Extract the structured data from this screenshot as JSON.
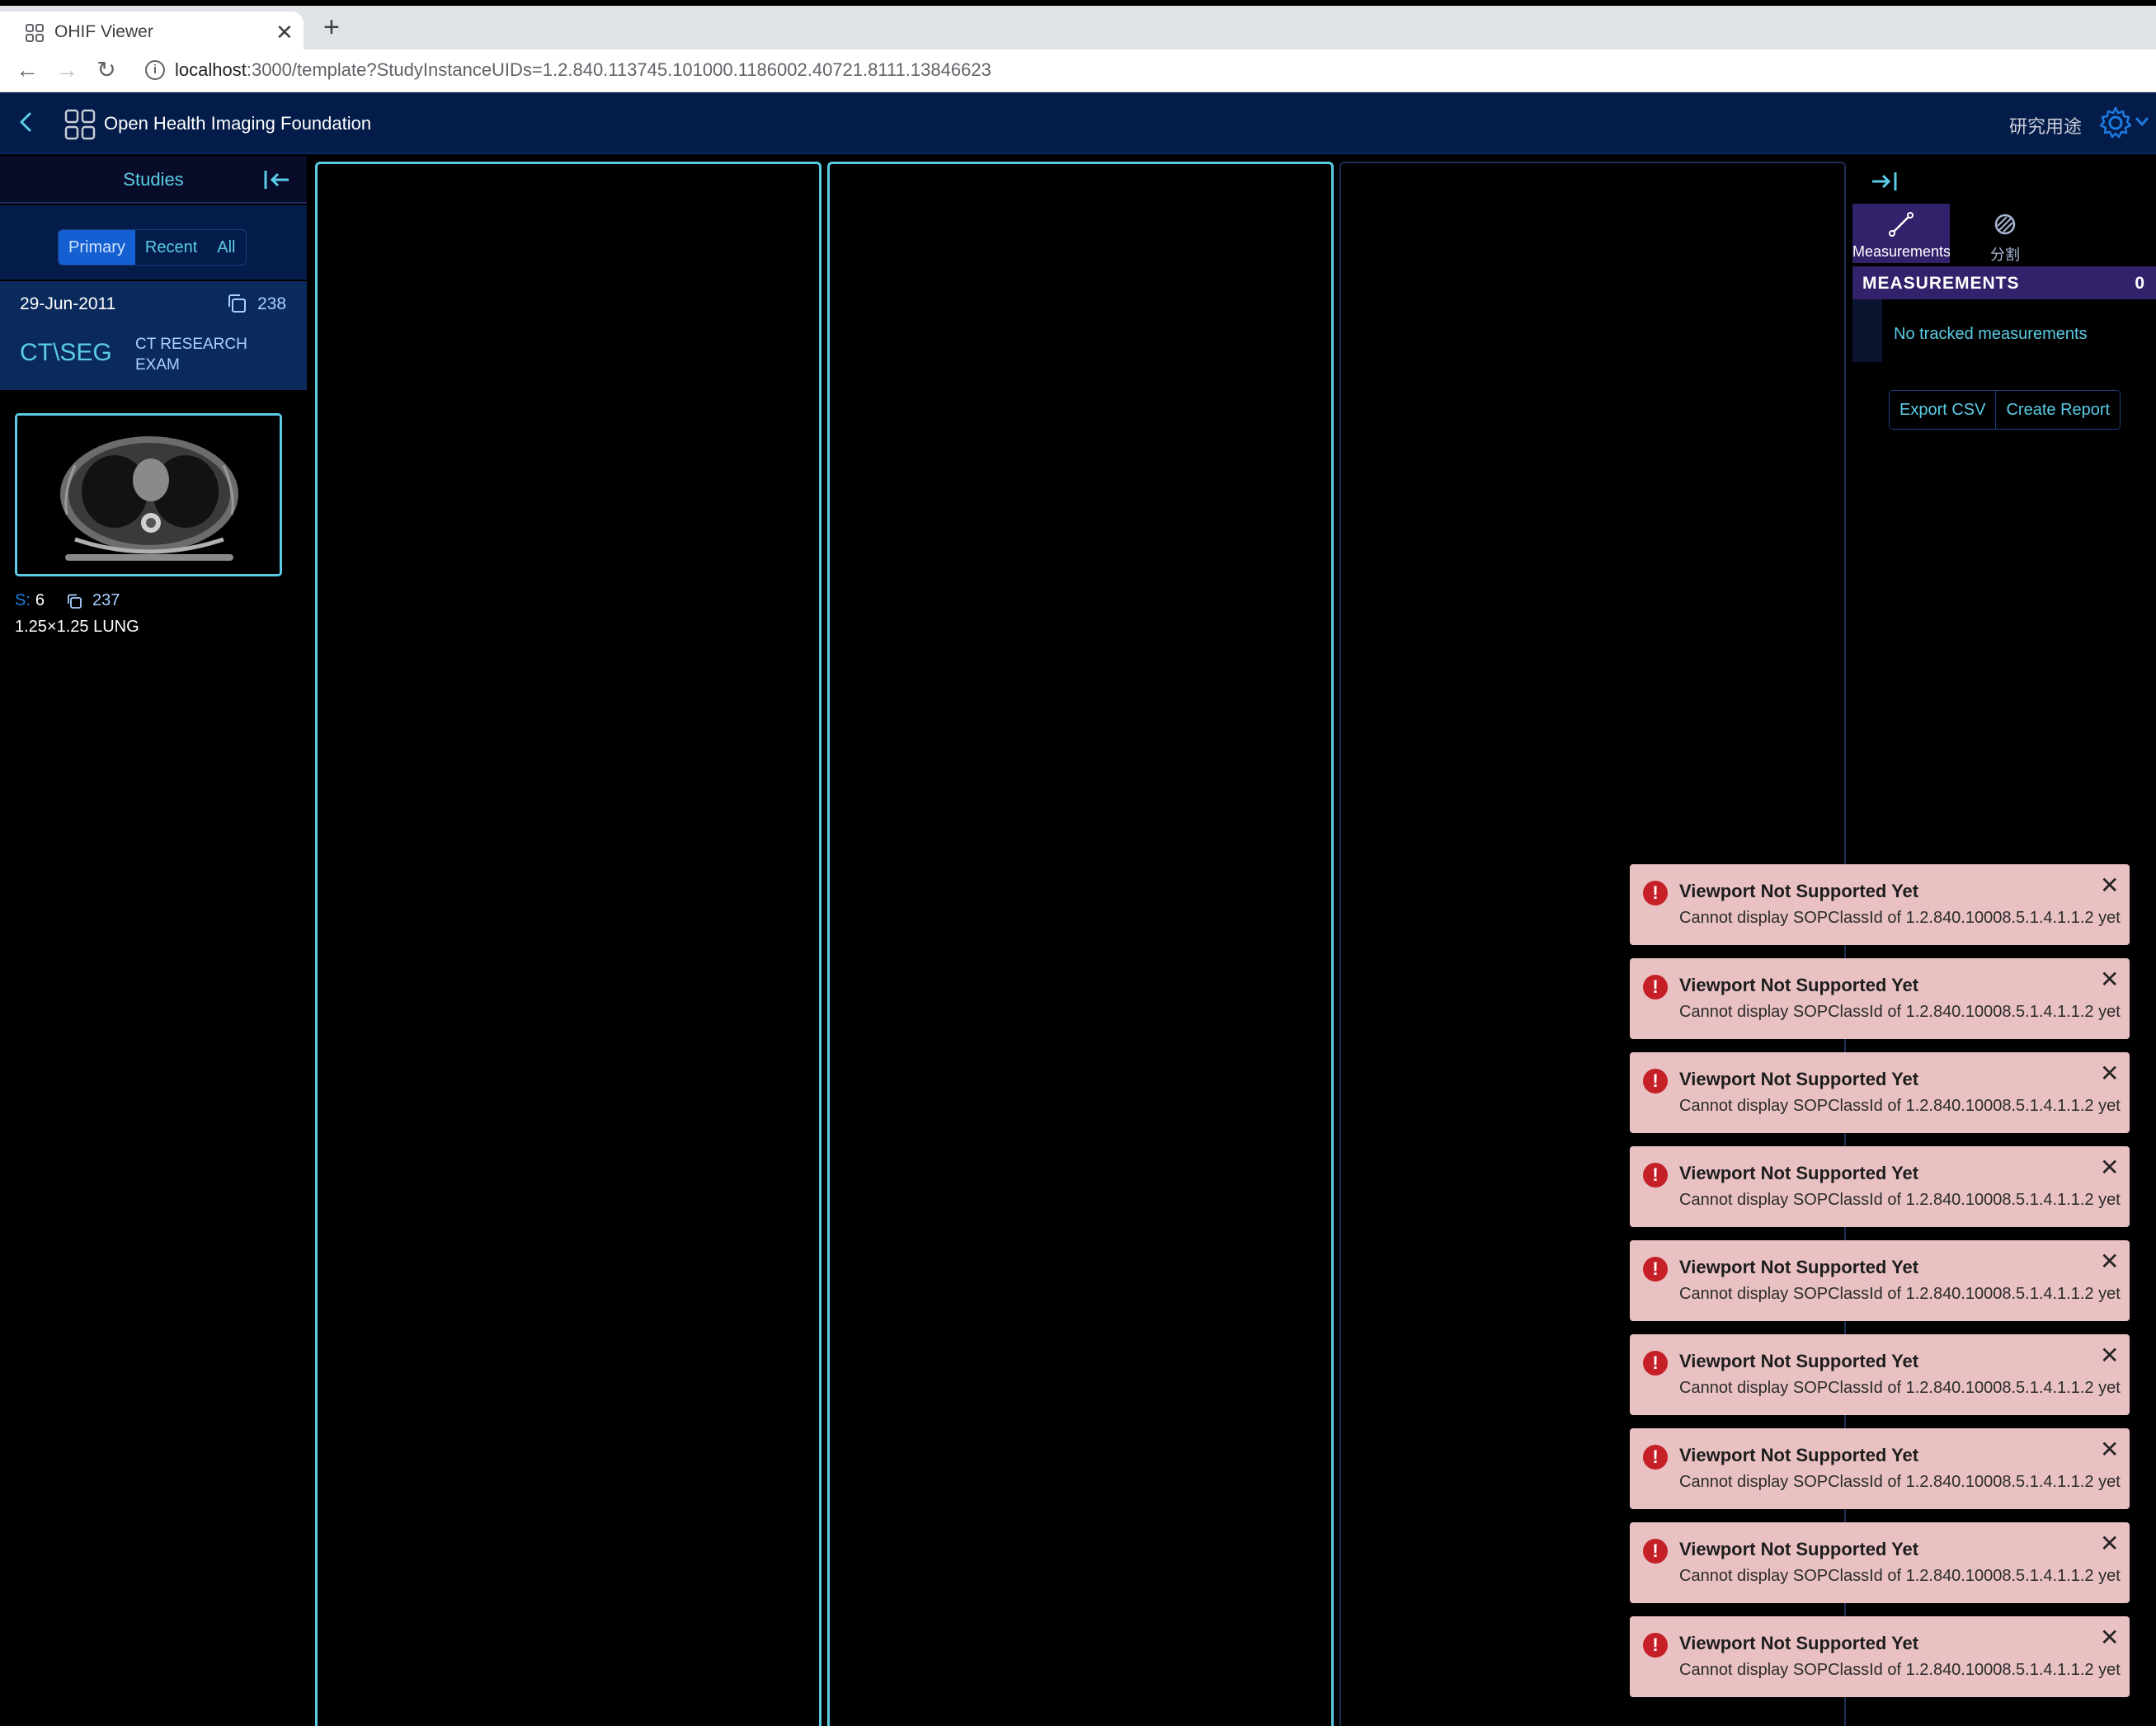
{
  "browser": {
    "tab_title": "OHIF Viewer",
    "url_host": "localhost",
    "url_rest": ":3000/template?StudyInstanceUIDs=1.2.840.113745.101000.1186002.40721.8111.13846623",
    "new_tab": "+",
    "close_tab": "✕"
  },
  "header": {
    "title": "Open Health Imaging Foundation",
    "research_label": "研究用途"
  },
  "left_panel": {
    "title": "Studies",
    "tabs": [
      {
        "label": "Primary",
        "active": true
      },
      {
        "label": "Recent",
        "active": false
      },
      {
        "label": "All",
        "active": false
      }
    ],
    "study": {
      "date": "29-Jun-2011",
      "instance_count": "238",
      "modality": "CT\\SEG",
      "description": "CT RESEARCH EXAM"
    },
    "series": {
      "prefix": "S:",
      "number": "6",
      "instances": "237",
      "description": "1.25×1.25 LUNG"
    }
  },
  "right_panel": {
    "tabs": [
      {
        "label": "Measurements",
        "icon": "measurement-line-icon",
        "active": true
      },
      {
        "label": "分割",
        "icon": "segmentation-icon",
        "active": false
      }
    ],
    "measurements_header": "MEASUREMENTS",
    "measurements_count": "0",
    "empty_text": "No tracked measurements",
    "export_csv": "Export CSV",
    "create_report": "Create Report"
  },
  "notifications": [
    {
      "title": "Viewport Not Supported Yet",
      "message": "Cannot display SOPClassId of 1.2.840.10008.5.1.4.1.1.2 yet"
    },
    {
      "title": "Viewport Not Supported Yet",
      "message": "Cannot display SOPClassId of 1.2.840.10008.5.1.4.1.1.2 yet"
    },
    {
      "title": "Viewport Not Supported Yet",
      "message": "Cannot display SOPClassId of 1.2.840.10008.5.1.4.1.1.2 yet"
    },
    {
      "title": "Viewport Not Supported Yet",
      "message": "Cannot display SOPClassId of 1.2.840.10008.5.1.4.1.1.2 yet"
    },
    {
      "title": "Viewport Not Supported Yet",
      "message": "Cannot display SOPClassId of 1.2.840.10008.5.1.4.1.1.2 yet"
    },
    {
      "title": "Viewport Not Supported Yet",
      "message": "Cannot display SOPClassId of 1.2.840.10008.5.1.4.1.1.2 yet"
    },
    {
      "title": "Viewport Not Supported Yet",
      "message": "Cannot display SOPClassId of 1.2.840.10008.5.1.4.1.1.2 yet"
    },
    {
      "title": "Viewport Not Supported Yet",
      "message": "Cannot display SOPClassId of 1.2.840.10008.5.1.4.1.1.2 yet"
    },
    {
      "title": "Viewport Not Supported Yet",
      "message": "Cannot display SOPClassId of 1.2.840.10008.5.1.4.1.1.2 yet"
    }
  ],
  "colors": {
    "header_bg": "#041c4a",
    "accent": "#5acce6",
    "active_tab": "#1460d2",
    "panel_purple": "#32216b",
    "toast_bg": "#e9c1c3",
    "toast_icon": "#c52027"
  }
}
